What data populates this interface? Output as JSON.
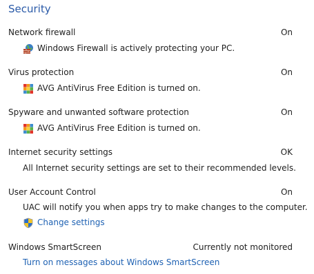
{
  "section": {
    "title": "Security"
  },
  "items": [
    {
      "title": "Network firewall",
      "status": "On",
      "description": "Windows Firewall is actively protecting your PC.",
      "icon": "firewall-icon"
    },
    {
      "title": "Virus protection",
      "status": "On",
      "description": "AVG AntiVirus Free Edition is turned on.",
      "icon": "avg-icon"
    },
    {
      "title": "Spyware and unwanted software protection",
      "status": "On",
      "description": "AVG AntiVirus Free Edition is turned on.",
      "icon": "avg-icon"
    },
    {
      "title": "Internet security settings",
      "status": "OK",
      "description": "All Internet security settings are set to their recommended levels."
    },
    {
      "title": "User Account Control",
      "status": "On",
      "description": "UAC will notify you when apps try to make changes to the computer.",
      "link": "Change settings",
      "link_icon": "uac-shield-icon"
    },
    {
      "title": "Windows SmartScreen",
      "status": "Currently not monitored",
      "link": "Turn on messages about Windows SmartScreen"
    }
  ],
  "colors": {
    "title": "#2a5aa8",
    "link": "#1f62b3",
    "text": "#1e1e1e"
  }
}
